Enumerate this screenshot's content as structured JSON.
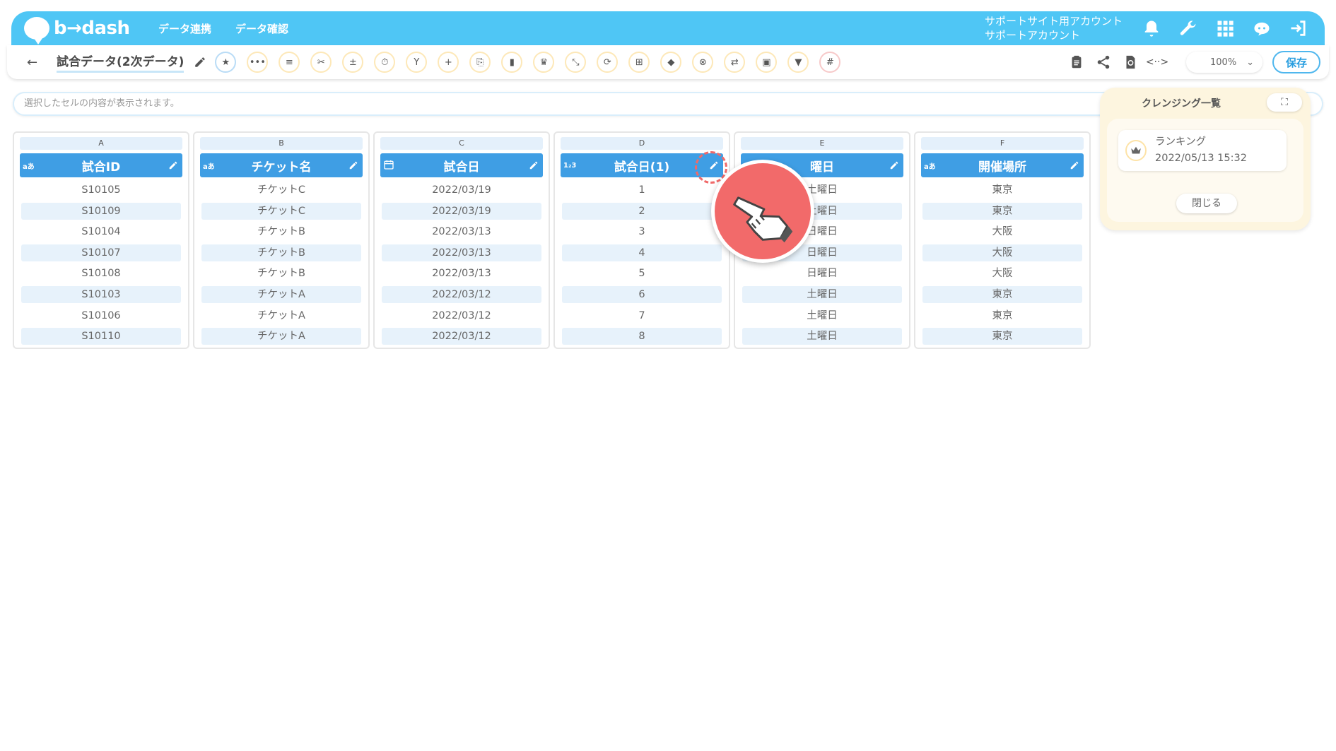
{
  "header": {
    "logo_text": "b→dash",
    "nav": [
      "データ連携",
      "データ確認"
    ],
    "account_line1": "サポートサイト用アカウント",
    "account_line2": "サポートアカウント"
  },
  "toolbar": {
    "back_label": "←",
    "title": "試合データ(2次データ)",
    "zoom": "100%",
    "save_label": "保存"
  },
  "cellbar": {
    "placeholder": "選択したセルの内容が表示されます。"
  },
  "columns": [
    {
      "letter": "A",
      "type": "aあ",
      "name": "試合ID",
      "cells": [
        "S10105",
        "S10109",
        "S10104",
        "S10107",
        "S10108",
        "S10103",
        "S10106",
        "S10110"
      ]
    },
    {
      "letter": "B",
      "type": "aあ",
      "name": "チケット名",
      "cells": [
        "チケットC",
        "チケットC",
        "チケットB",
        "チケットB",
        "チケットB",
        "チケットA",
        "チケットA",
        "チケットA"
      ]
    },
    {
      "letter": "C",
      "type": "calendar",
      "name": "試合日",
      "cells": [
        "2022/03/19",
        "2022/03/19",
        "2022/03/13",
        "2022/03/13",
        "2022/03/13",
        "2022/03/12",
        "2022/03/12",
        "2022/03/12"
      ]
    },
    {
      "letter": "D",
      "type": "1₂3",
      "name": "試合日(1)",
      "cells": [
        "1",
        "2",
        "3",
        "4",
        "5",
        "6",
        "7",
        "8"
      ]
    },
    {
      "letter": "E",
      "type": "",
      "name": "曜日",
      "cells": [
        "土曜日",
        "土曜日",
        "日曜日",
        "日曜日",
        "日曜日",
        "土曜日",
        "土曜日",
        "土曜日"
      ]
    },
    {
      "letter": "F",
      "type": "aあ",
      "name": "開催場所",
      "cells": [
        "東京",
        "東京",
        "大阪",
        "大阪",
        "大阪",
        "東京",
        "東京",
        "東京"
      ]
    }
  ],
  "cleansing": {
    "title": "クレンジング一覧",
    "item_name": "ランキング",
    "item_date": "2022/05/13 15:32",
    "close_label": "閉じる"
  },
  "colors": {
    "header_bg": "#4fc6f5",
    "column_header_bg": "#3f9ee4",
    "row_alt": "#e7f2fb",
    "pointer": "#f26a6a",
    "panel_bg": "#fdf5df"
  }
}
